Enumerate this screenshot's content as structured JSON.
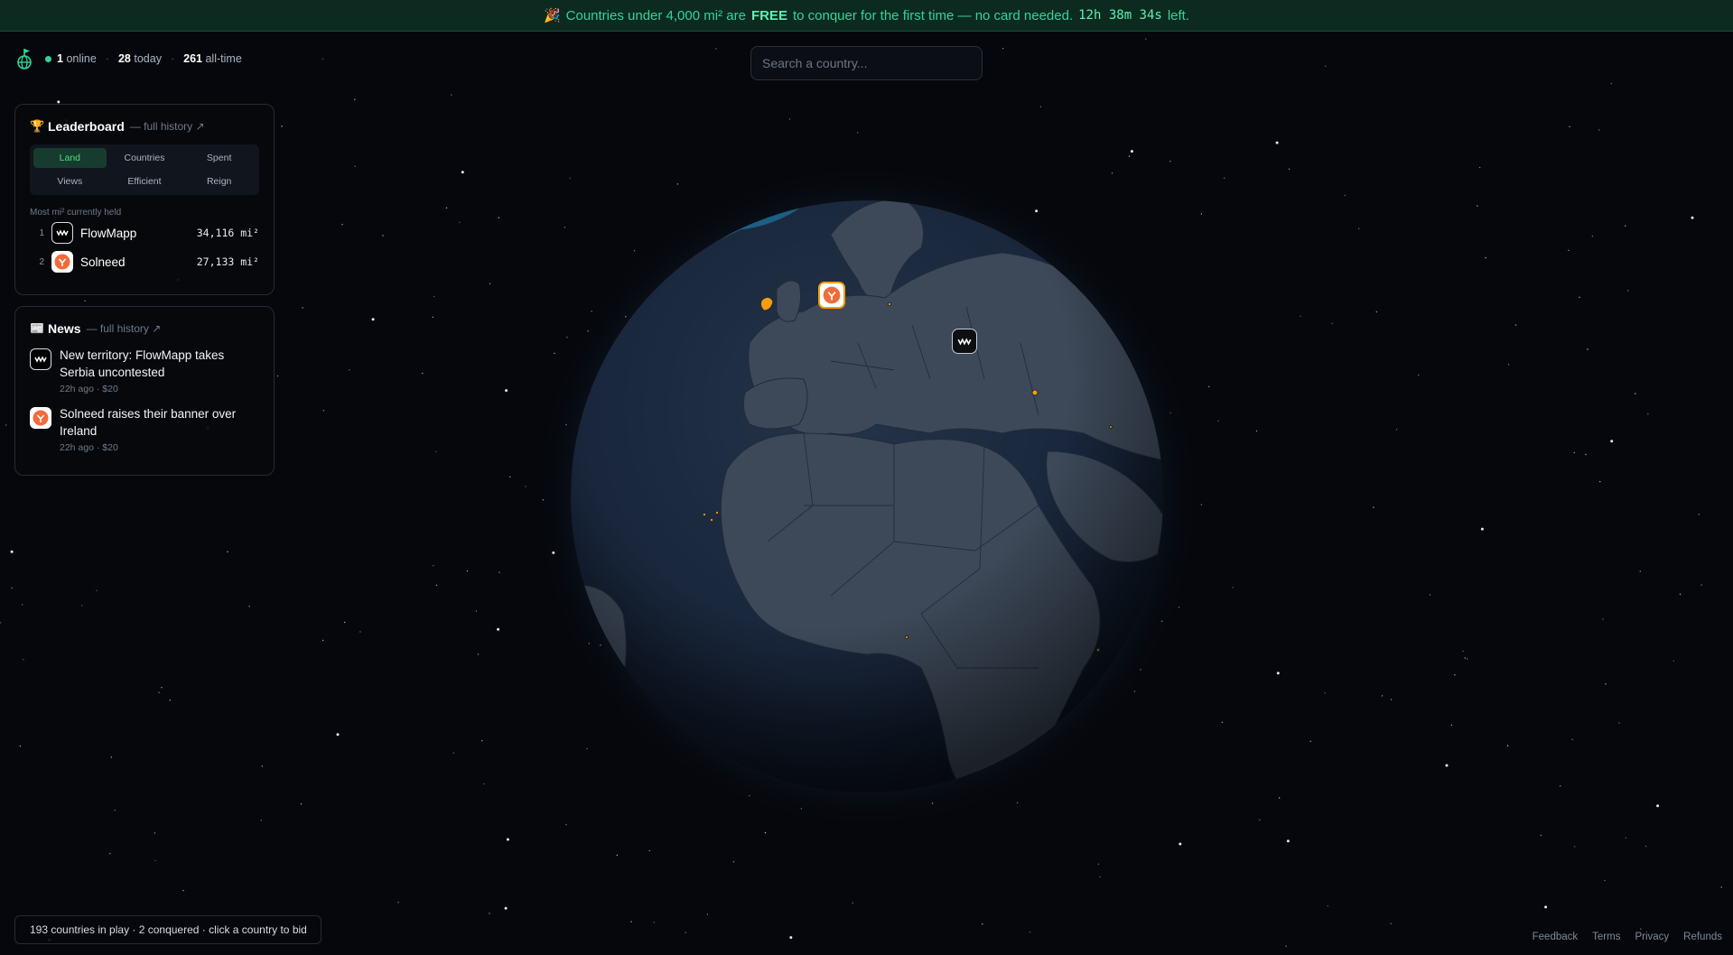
{
  "banner": {
    "emoji": "🎉",
    "text_before": "Countries under 4,000 mi² are",
    "free": "FREE",
    "text_after": "to conquer for the first time — no card needed.",
    "countdown": "12h 38m 34s",
    "left": "left."
  },
  "stats": {
    "online_count": "1",
    "online_label": "online",
    "today_count": "28",
    "today_label": "today",
    "alltime_count": "261",
    "alltime_label": "all-time"
  },
  "search": {
    "placeholder": "Search a country..."
  },
  "leaderboard": {
    "icon": "🏆",
    "title": "Leaderboard",
    "history_link": "— full history ↗",
    "tabs": [
      "Land",
      "Countries",
      "Spent",
      "Views",
      "Efficient",
      "Reign"
    ],
    "active_tab": "Land",
    "subheading": "Most mi² currently held",
    "entries": [
      {
        "rank": "1",
        "name": "FlowMapp",
        "value": "34,116 mi²",
        "icon": "flowmapp-logo-icon"
      },
      {
        "rank": "2",
        "name": "Solneed",
        "value": "27,133 mi²",
        "icon": "solneed-logo-icon"
      }
    ]
  },
  "news": {
    "icon": "📰",
    "title": "News",
    "history_link": "— full history ↗",
    "items": [
      {
        "text": "New territory: FlowMapp takes Serbia uncontested",
        "meta": "22h ago · $20",
        "icon": "flowmapp-logo-icon"
      },
      {
        "text": "Solneed raises their banner over Ireland",
        "meta": "22h ago · $20",
        "icon": "solneed-logo-icon"
      }
    ]
  },
  "status_bar": {
    "text": "193 countries in play · 2 conquered · click a country to bid"
  },
  "footer": {
    "links": [
      "Feedback",
      "Terms",
      "Privacy",
      "Refunds"
    ]
  },
  "colors": {
    "accent": "#34d399",
    "background": "#05070c",
    "ocean": "#1a2433",
    "land": "#3a4656",
    "claimed": "#f59e0b"
  }
}
